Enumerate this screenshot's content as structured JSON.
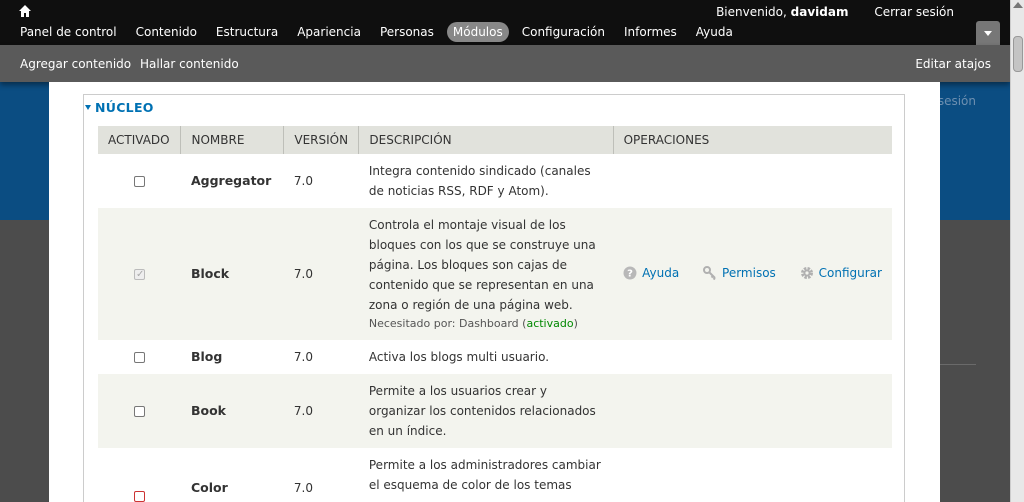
{
  "toolbar": {
    "welcome": "Bienvenido,",
    "username": "davidam",
    "logout": "Cerrar sesión",
    "menu": [
      {
        "label": "Panel de control",
        "active": false
      },
      {
        "label": "Contenido",
        "active": false
      },
      {
        "label": "Estructura",
        "active": false
      },
      {
        "label": "Apariencia",
        "active": false
      },
      {
        "label": "Personas",
        "active": false
      },
      {
        "label": "Módulos",
        "active": true
      },
      {
        "label": "Configuración",
        "active": false
      },
      {
        "label": "Informes",
        "active": false
      },
      {
        "label": "Ayuda",
        "active": false
      }
    ]
  },
  "shortcuts": {
    "items": [
      "Agregar contenido",
      "Hallar contenido"
    ],
    "edit": "Editar atajos"
  },
  "background": {
    "logout_fragment": "sesión"
  },
  "modules": {
    "fieldset_title": "NÚCLEO",
    "columns": [
      "ACTIVADO",
      "NOMBRE",
      "VERSIÓN",
      "DESCRIPCIÓN",
      "OPERACIONES"
    ],
    "rows": [
      {
        "name": "Aggregator",
        "version": "7.0",
        "description": "Integra contenido sindicado (canales de noticias RSS, RDF y Atom).",
        "checked": false
      },
      {
        "name": "Block",
        "version": "7.0",
        "description": "Controla el montaje visual de los bloques con los que se construye una página. Los bloques son cajas de contenido que se representan en una zona o región de una página web.",
        "required_by_label": "Necesitado por: Dashboard (",
        "required_by_status": "activado",
        "required_by_close": ")",
        "checked": true,
        "disabled": true,
        "operations": [
          "Ayuda",
          "Permisos",
          "Configurar"
        ]
      },
      {
        "name": "Blog",
        "version": "7.0",
        "description": "Activa los blogs multi usuario.",
        "checked": false
      },
      {
        "name": "Book",
        "version": "7.0",
        "description": "Permite a los usuarios crear y organizar los contenidos relacionados en un índice.",
        "checked": false
      },
      {
        "name": "Color",
        "version": "7.0",
        "description": "Permite a los administradores cambiar el esquema de color de los temas",
        "checked": true
      }
    ]
  },
  "colors": {
    "link": "#0071b3",
    "toolbar_bg": "#0f0f0f",
    "active_tab": "#888888"
  }
}
